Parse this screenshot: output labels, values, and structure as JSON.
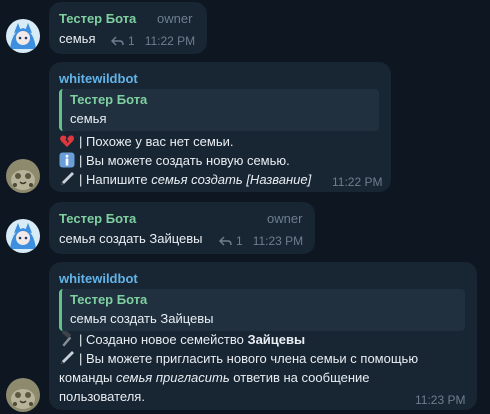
{
  "messages": [
    {
      "author": "Тестер Бота",
      "role": "owner",
      "text": "семья",
      "reply_count": "1",
      "time": "11:22 PM"
    },
    {
      "author": "whitewildbot",
      "quote_author": "Тестер Бота",
      "quote_text": "семья",
      "lines": [
        {
          "icon": "broken-heart-icon",
          "text": "| Похоже у вас нет семьи."
        },
        {
          "icon": "info-icon",
          "text": "| Вы можете создать новую семью."
        },
        {
          "icon": "pen-icon",
          "prefix": "| Напишите ",
          "italic": "семья создать [Название]"
        }
      ],
      "time": "11:22 PM"
    },
    {
      "author": "Тестер Бота",
      "role": "owner",
      "text": "семья создать Зайцевы",
      "reply_count": "1",
      "time": "11:23 PM"
    },
    {
      "author": "whitewildbot",
      "quote_author": "Тестер Бота",
      "quote_text": "семья создать Зайцевы",
      "line1_prefix": "| Создано новое семейство ",
      "line1_bold": "Зайцевы",
      "line2": "| Вы можете пригласить нового члена семьи с помощью",
      "line3_prefix": "команды ",
      "line3_italic": "семья пригласить",
      "line3_suffix": " ответив на сообщение",
      "line4": "пользователя.",
      "time": "11:23 PM"
    }
  ],
  "colors": {
    "background": "#0e1621",
    "bubble": "#182533",
    "user_name": "#7fd0a0",
    "bot_name": "#62b4e8",
    "meta": "#6d7f8f"
  }
}
